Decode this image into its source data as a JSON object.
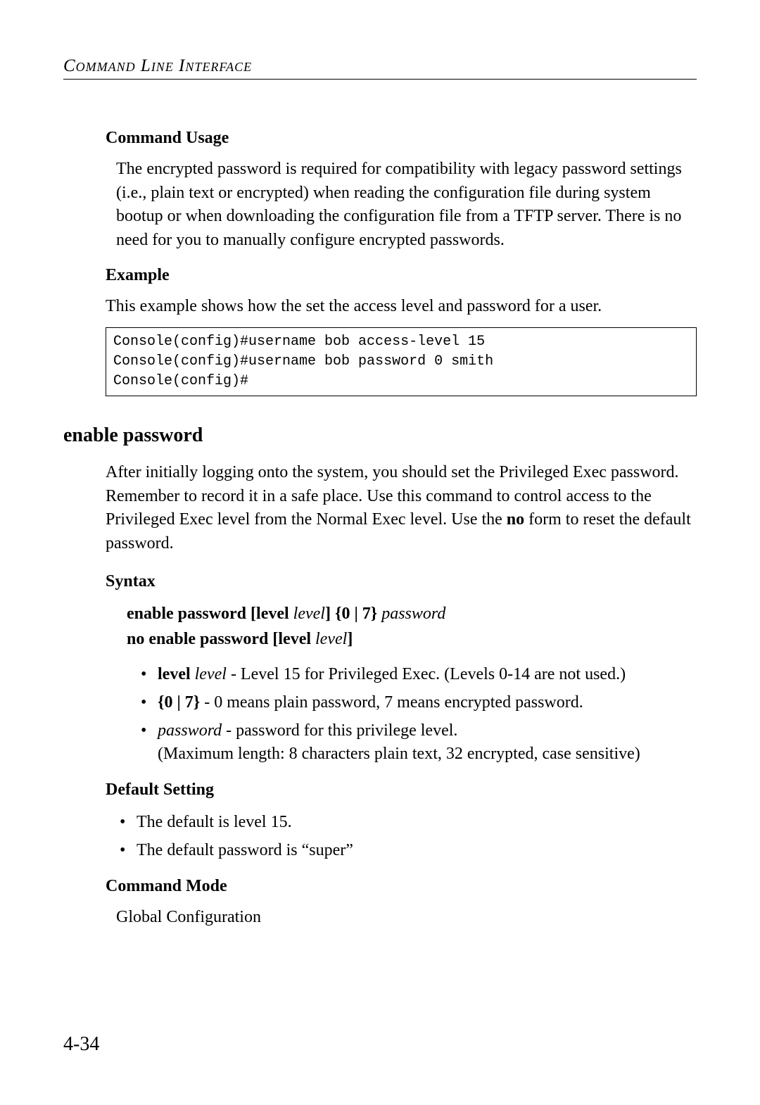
{
  "header": {
    "title": "Command Line Interface"
  },
  "sections": {
    "commandUsage": {
      "title": "Command Usage",
      "text": "The encrypted password is required for compatibility with legacy password settings (i.e., plain text or encrypted) when reading the configuration file during system bootup or when downloading the configuration file from a TFTP server. There is no need for you to manually configure encrypted passwords."
    },
    "example": {
      "title": "Example",
      "intro": "This example shows how the set the access level and password for a user.",
      "code": "Console(config)#username bob access-level 15\nConsole(config)#username bob password 0 smith\nConsole(config)#"
    },
    "enablePassword": {
      "title": "enable password",
      "description_part1": "After initially logging onto the system, you should set the Privileged Exec password. Remember to record it in a safe place. Use this command to control access to the Privileged Exec level from the Normal Exec level. Use the ",
      "description_bold": "no",
      "description_part2": " form to reset the default password."
    },
    "syntax": {
      "title": "Syntax",
      "line1": {
        "p1": "enable password ",
        "p2": "[",
        "p3": "level ",
        "p4": "level",
        "p5": "]",
        "p6": " {",
        "p7": "0 ",
        "p8": "| ",
        "p9": "7",
        "p10": "} ",
        "p11": "password"
      },
      "line2": {
        "p1": "no enable password ",
        "p2": "[",
        "p3": "level ",
        "p4": "level",
        "p5": "]"
      },
      "bullets": {
        "b1": {
          "bold": "level ",
          "italic": "level",
          "rest": " - Level 15 for Privileged Exec. (Levels 0-14 are not used.)"
        },
        "b2": {
          "bold": "{0 | 7}",
          "rest": " - 0 means plain password, 7 means encrypted password."
        },
        "b3": {
          "italic": "password",
          "rest": " - password for this privilege level.",
          "cont": "(Maximum length: 8 characters plain text, 32 encrypted, case sensitive)"
        }
      }
    },
    "defaultSetting": {
      "title": "Default Setting",
      "bullets": {
        "b1": "The default is level 15.",
        "b2": "The default password is “super”"
      }
    },
    "commandMode": {
      "title": "Command Mode",
      "text": "Global Configuration"
    }
  },
  "pageNumber": "4-34"
}
